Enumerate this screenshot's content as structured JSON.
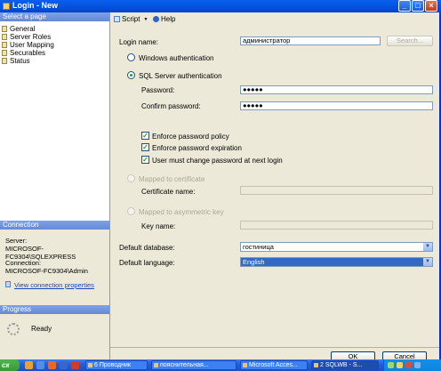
{
  "window": {
    "title": "Login - New"
  },
  "sidebar": {
    "header": "Select a page",
    "pages": [
      "General",
      "Server Roles",
      "User Mapping",
      "Securables",
      "Status"
    ]
  },
  "connection": {
    "header": "Connection",
    "server_label": "Server:",
    "server_value": "MICROSOF-FC9304\\SQLEXPRESS",
    "connection_label": "Connection:",
    "connection_value": "MICROSOF-FC9304\\Admin",
    "view_link": "View connection properties"
  },
  "progress": {
    "header": "Progress",
    "status": "Ready"
  },
  "toolbar": {
    "script_label": "Script",
    "help_label": "Help"
  },
  "form": {
    "login_name_label": "Login name:",
    "login_name_value": "администратор",
    "search_button": "Search...",
    "windows_auth_label": "Windows authentication",
    "sql_auth_label": "SQL Server authentication",
    "password_label": "Password:",
    "password_value": "●●●●●",
    "confirm_label": "Confirm password:",
    "confirm_value": "●●●●●",
    "enforce_policy_label": "Enforce password policy",
    "enforce_expiration_label": "Enforce password expiration",
    "must_change_label": "User must change password at next login",
    "mapped_cert_label": "Mapped to certificate",
    "cert_name_label": "Certificate name:",
    "mapped_key_label": "Mapped to asymmetric key",
    "key_name_label": "Key name:",
    "default_db_label": "Default database:",
    "default_db_value": "гостиница",
    "default_lang_label": "Default language:",
    "default_lang_value": "English",
    "checkmark": "✓",
    "dropdown_arrow": "▼"
  },
  "buttons": {
    "ok": "OK",
    "cancel": "Cancel"
  },
  "taskbar": {
    "start_label": "ск",
    "tasks": [
      "6 Проводник",
      "пояснительная...",
      "Microsoft Acces...",
      "2 SQLWB - S..."
    ]
  },
  "colors": {
    "title_bar": "#0454E0",
    "sidebar_header": "#7BA2E7",
    "selection": "#316AC5"
  }
}
